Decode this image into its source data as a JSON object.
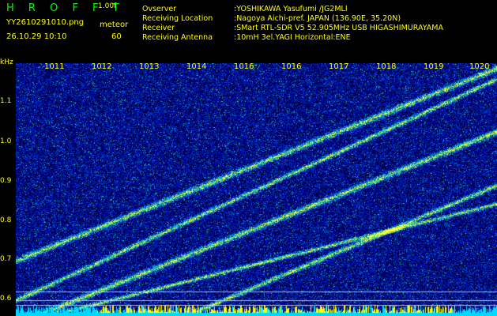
{
  "app": {
    "logo": "H R O F F T",
    "version": "1.00f",
    "filename": "YY2610291010.png",
    "meteor_label": "meteor",
    "meteor_count": "60",
    "datetime": "26.10.29 10:10"
  },
  "info": [
    {
      "key": "Ovserver",
      "value": ":YOSHIKAWA Yasufumi /JG2MLI"
    },
    {
      "key": "Receiving Location",
      "value": ":Nagoya Aichi-pref. JAPAN (136.90E, 35.20N)"
    },
    {
      "key": "Receiver",
      "value": ":SMart RTL-SDR V5 52.905MHz USB HIGASHIMURAYAMA"
    },
    {
      "key": "Receiving Antenna",
      "value": ":10mH 3el.YAGI Horizontal:ENE"
    }
  ],
  "axis": {
    "unit": "kHz",
    "y_ticks": [
      "1.1",
      "1.0",
      "0.9",
      "0.8",
      "0.7",
      "0.6"
    ],
    "x_ticks": [
      "1011",
      "1012",
      "1013",
      "1014",
      "1016",
      "1016",
      "1017",
      "1018",
      "1019",
      "1020"
    ]
  },
  "colors": {
    "text": "#ffff00",
    "logo": "#00ff00",
    "noise_floor": "#00d8ff",
    "interference": "#ffff00"
  }
}
